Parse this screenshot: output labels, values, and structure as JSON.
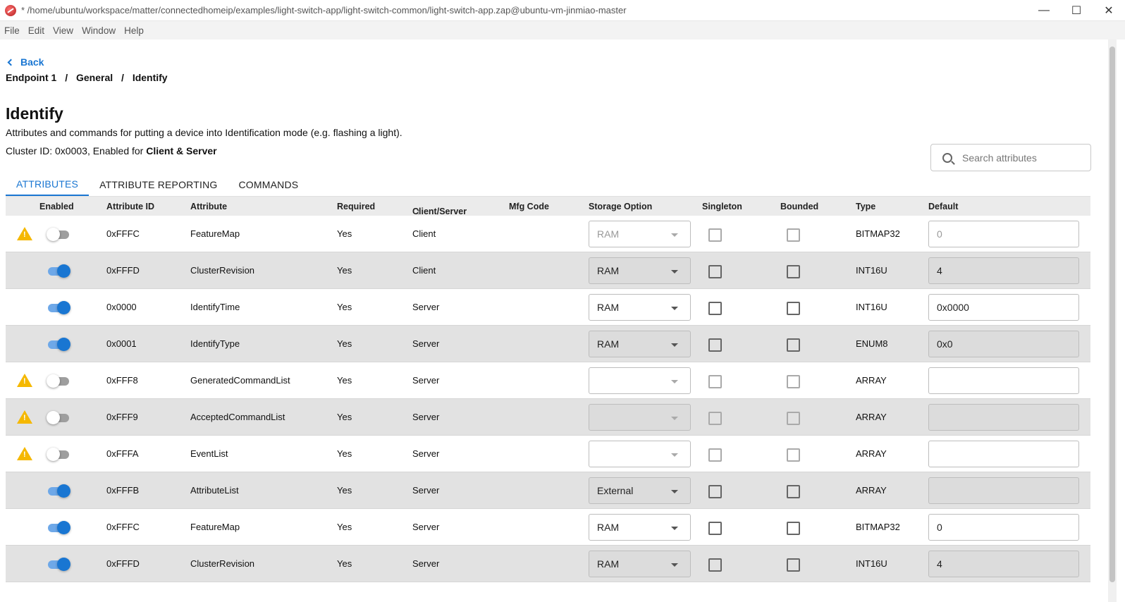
{
  "window": {
    "title": "* /home/ubuntu/workspace/matter/connectedhomeip/examples/light-switch-app/light-switch-common/light-switch-app.zap@ubuntu-vm-jinmiao-master",
    "minimize": "—",
    "maximize": "☐",
    "close": "✕"
  },
  "menu": [
    "File",
    "Edit",
    "View",
    "Window",
    "Help"
  ],
  "nav": {
    "back_label": "Back",
    "breadcrumb": [
      "Endpoint 1",
      "General",
      "Identify"
    ],
    "separator": "/"
  },
  "cluster": {
    "title": "Identify",
    "description": "Attributes and commands for putting a device into Identification mode (e.g. flashing a light).",
    "info_prefix": "Cluster ID: 0x0003, Enabled for ",
    "info_bold": "Client & Server"
  },
  "search": {
    "placeholder": "Search attributes"
  },
  "tabs": [
    "ATTRIBUTES",
    "ATTRIBUTE REPORTING",
    "COMMANDS"
  ],
  "table": {
    "headers": {
      "enabled": "Enabled",
      "attribute_id": "Attribute ID",
      "attribute": "Attribute",
      "required": "Required",
      "client_server": "Client/Server",
      "sort_arrow": "↑",
      "mfg_code": "Mfg Code",
      "storage_option": "Storage Option",
      "singleton": "Singleton",
      "bounded": "Bounded",
      "type": "Type",
      "default": "Default"
    },
    "rows": [
      {
        "warn": true,
        "enabled": false,
        "id": "0xFFFC",
        "name": "FeatureMap",
        "required": "Yes",
        "side": "Client",
        "mfg": "",
        "storage": "RAM",
        "type": "BITMAP32",
        "default": "0"
      },
      {
        "warn": false,
        "enabled": true,
        "id": "0xFFFD",
        "name": "ClusterRevision",
        "required": "Yes",
        "side": "Client",
        "mfg": "",
        "storage": "RAM",
        "type": "INT16U",
        "default": "4"
      },
      {
        "warn": false,
        "enabled": true,
        "id": "0x0000",
        "name": "IdentifyTime",
        "required": "Yes",
        "side": "Server",
        "mfg": "",
        "storage": "RAM",
        "type": "INT16U",
        "default": "0x0000"
      },
      {
        "warn": false,
        "enabled": true,
        "id": "0x0001",
        "name": "IdentifyType",
        "required": "Yes",
        "side": "Server",
        "mfg": "",
        "storage": "RAM",
        "type": "ENUM8",
        "default": "0x0"
      },
      {
        "warn": true,
        "enabled": false,
        "id": "0xFFF8",
        "name": "GeneratedCommandList",
        "required": "Yes",
        "side": "Server",
        "mfg": "",
        "storage": "",
        "type": "ARRAY",
        "default": ""
      },
      {
        "warn": true,
        "enabled": false,
        "id": "0xFFF9",
        "name": "AcceptedCommandList",
        "required": "Yes",
        "side": "Server",
        "mfg": "",
        "storage": "",
        "type": "ARRAY",
        "default": ""
      },
      {
        "warn": true,
        "enabled": false,
        "id": "0xFFFA",
        "name": "EventList",
        "required": "Yes",
        "side": "Server",
        "mfg": "",
        "storage": "",
        "type": "ARRAY",
        "default": ""
      },
      {
        "warn": false,
        "enabled": true,
        "id": "0xFFFB",
        "name": "AttributeList",
        "required": "Yes",
        "side": "Server",
        "mfg": "",
        "storage": "External",
        "type": "ARRAY",
        "default": ""
      },
      {
        "warn": false,
        "enabled": true,
        "id": "0xFFFC",
        "name": "FeatureMap",
        "required": "Yes",
        "side": "Server",
        "mfg": "",
        "storage": "RAM",
        "type": "BITMAP32",
        "default": "0"
      },
      {
        "warn": false,
        "enabled": true,
        "id": "0xFFFD",
        "name": "ClusterRevision",
        "required": "Yes",
        "side": "Server",
        "mfg": "",
        "storage": "RAM",
        "type": "INT16U",
        "default": "4"
      }
    ]
  },
  "colors": {
    "accent": "#1976d2",
    "warning": "#f5b800",
    "row_alt": "#e2e2e2"
  }
}
